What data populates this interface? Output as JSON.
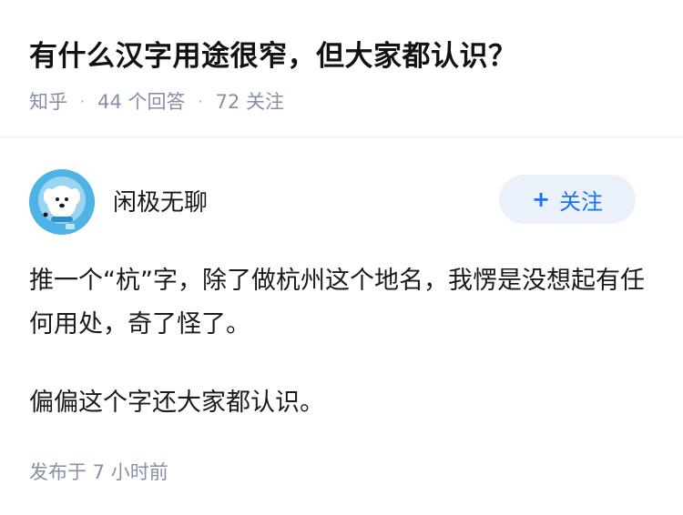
{
  "question": {
    "title": "有什么汉字用途很窄，但大家都认识？",
    "source": "知乎",
    "answers_count": "44 个回答",
    "followers_count": "72 关注"
  },
  "answer": {
    "author_name": "闲极无聊",
    "avatar_icon": "dog-astronaut-avatar",
    "follow_label": "关注",
    "follow_icon": "plus-icon",
    "paragraphs": [
      "推一个“杭”字，除了做杭州这个地名，我愣是没想起有任何用处，奇了怪了。",
      "偏偏这个字还大家都认识。"
    ],
    "published_time": "发布于  7 小时前"
  },
  "colors": {
    "accent": "#1772f6",
    "follow_bg": "#eaf1fb",
    "meta_text": "#8590a6",
    "avatar_bg": "#4fb3e6"
  }
}
